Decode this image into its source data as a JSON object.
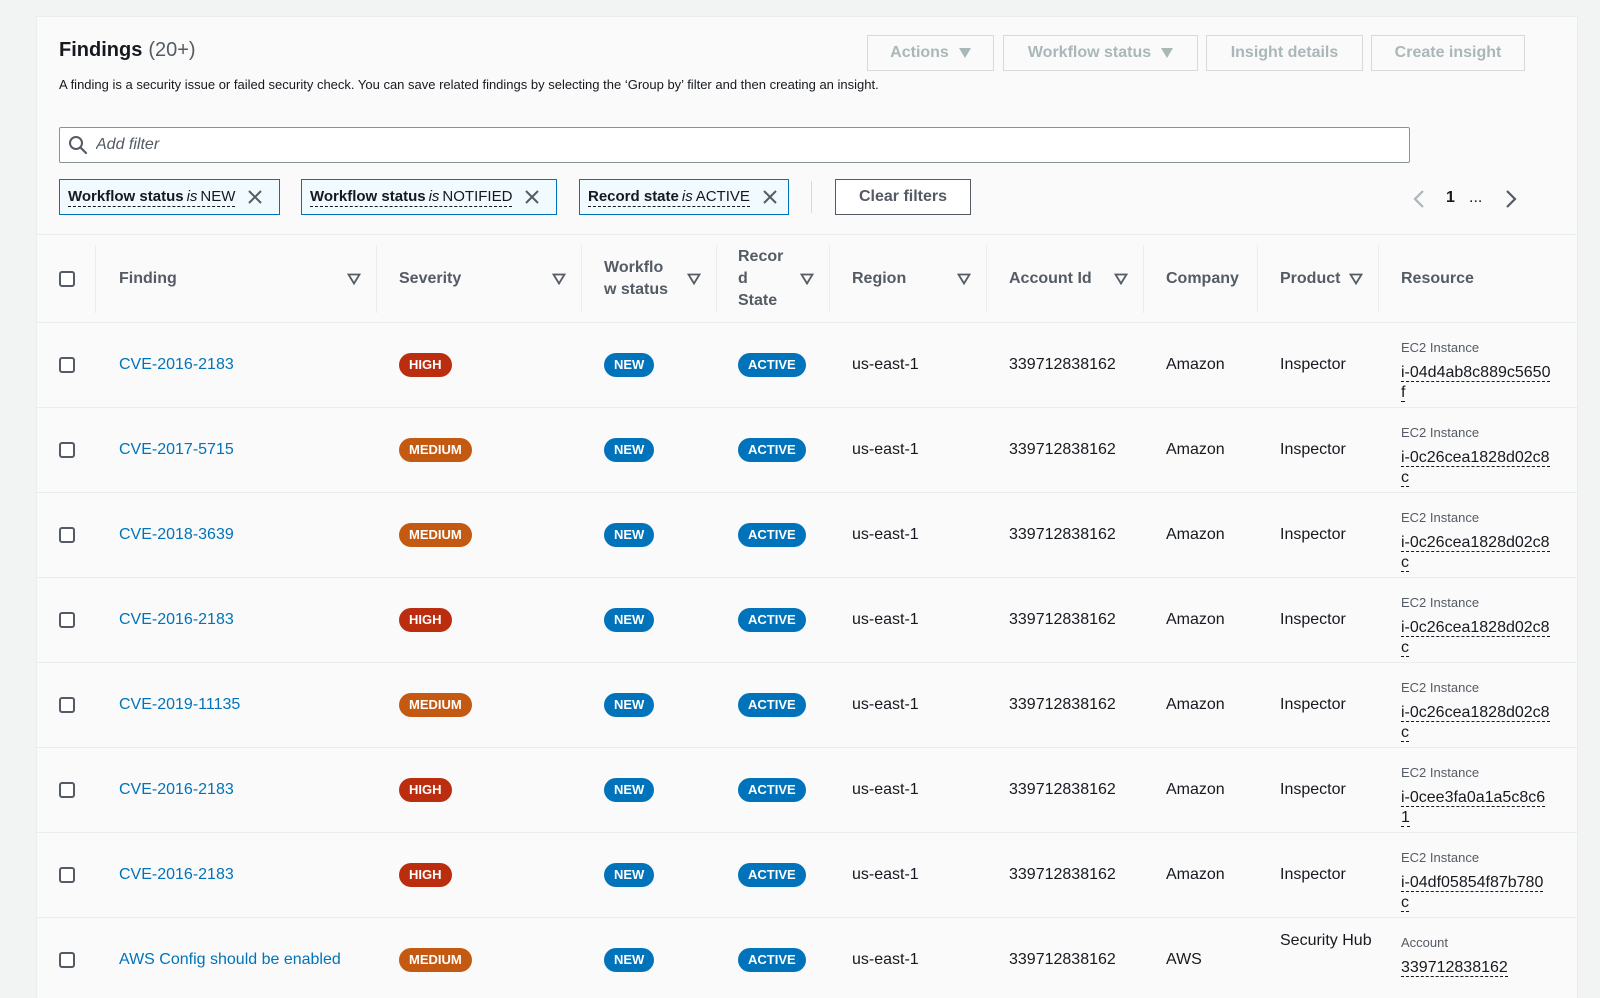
{
  "header": {
    "title": "Findings",
    "count": "(20+)",
    "description": "A finding is a security issue or failed security check. You can save related findings by selecting the ‘Group by’ filter and then creating an insight.",
    "actions_label": "Actions",
    "workflow_status_label": "Workflow status",
    "insight_details_label": "Insight details",
    "create_insight_label": "Create insight"
  },
  "filter": {
    "placeholder": "Add filter",
    "tokens": [
      {
        "field": "Workflow status",
        "op": "is",
        "value": "NEW"
      },
      {
        "field": "Workflow status",
        "op": "is",
        "value": "NOTIFIED"
      },
      {
        "field": "Record state",
        "op": "is",
        "value": "ACTIVE"
      }
    ],
    "clear_label": "Clear filters"
  },
  "pagination": {
    "page": "1",
    "ellipsis": "..."
  },
  "columns": {
    "finding": "Finding",
    "severity": "Severity",
    "workflow": "Workflo w status",
    "record": "Recor d State",
    "region": "Region",
    "account": "Account Id",
    "company": "Company",
    "product": "Product",
    "resource": "Resource"
  },
  "colors": {
    "high": "#ba2e0f",
    "medium": "#c45a12",
    "new": "#0073bb",
    "active": "#0073bb",
    "link": "#0073bb"
  },
  "rows": [
    {
      "finding": "CVE-2016-2183",
      "severity": "HIGH",
      "workflow": "NEW",
      "record": "ACTIVE",
      "region": "us-east-1",
      "account": "339712838162",
      "company": "Amazon",
      "product": "Inspector",
      "resource_type": "EC2 Instance",
      "resource_id": "i-04d4ab8c889c5650f"
    },
    {
      "finding": "CVE-2017-5715",
      "severity": "MEDIUM",
      "workflow": "NEW",
      "record": "ACTIVE",
      "region": "us-east-1",
      "account": "339712838162",
      "company": "Amazon",
      "product": "Inspector",
      "resource_type": "EC2 Instance",
      "resource_id": "i-0c26cea1828d02c8c"
    },
    {
      "finding": "CVE-2018-3639",
      "severity": "MEDIUM",
      "workflow": "NEW",
      "record": "ACTIVE",
      "region": "us-east-1",
      "account": "339712838162",
      "company": "Amazon",
      "product": "Inspector",
      "resource_type": "EC2 Instance",
      "resource_id": "i-0c26cea1828d02c8c"
    },
    {
      "finding": "CVE-2016-2183",
      "severity": "HIGH",
      "workflow": "NEW",
      "record": "ACTIVE",
      "region": "us-east-1",
      "account": "339712838162",
      "company": "Amazon",
      "product": "Inspector",
      "resource_type": "EC2 Instance",
      "resource_id": "i-0c26cea1828d02c8c"
    },
    {
      "finding": "CVE-2019-11135",
      "severity": "MEDIUM",
      "workflow": "NEW",
      "record": "ACTIVE",
      "region": "us-east-1",
      "account": "339712838162",
      "company": "Amazon",
      "product": "Inspector",
      "resource_type": "EC2 Instance",
      "resource_id": "i-0c26cea1828d02c8c"
    },
    {
      "finding": "CVE-2016-2183",
      "severity": "HIGH",
      "workflow": "NEW",
      "record": "ACTIVE",
      "region": "us-east-1",
      "account": "339712838162",
      "company": "Amazon",
      "product": "Inspector",
      "resource_type": "EC2 Instance",
      "resource_id": "i-0cee3fa0a1a5c8c61"
    },
    {
      "finding": "CVE-2016-2183",
      "severity": "HIGH",
      "workflow": "NEW",
      "record": "ACTIVE",
      "region": "us-east-1",
      "account": "339712838162",
      "company": "Amazon",
      "product": "Inspector",
      "resource_type": "EC2 Instance",
      "resource_id": "i-04df05854f87b780c"
    },
    {
      "finding": "AWS Config should be enabled",
      "severity": "MEDIUM",
      "workflow": "NEW",
      "record": "ACTIVE",
      "region": "us-east-1",
      "account": "339712838162",
      "company": "AWS",
      "product": "Security Hub",
      "resource_type": "Account",
      "resource_id": "339712838162"
    }
  ]
}
